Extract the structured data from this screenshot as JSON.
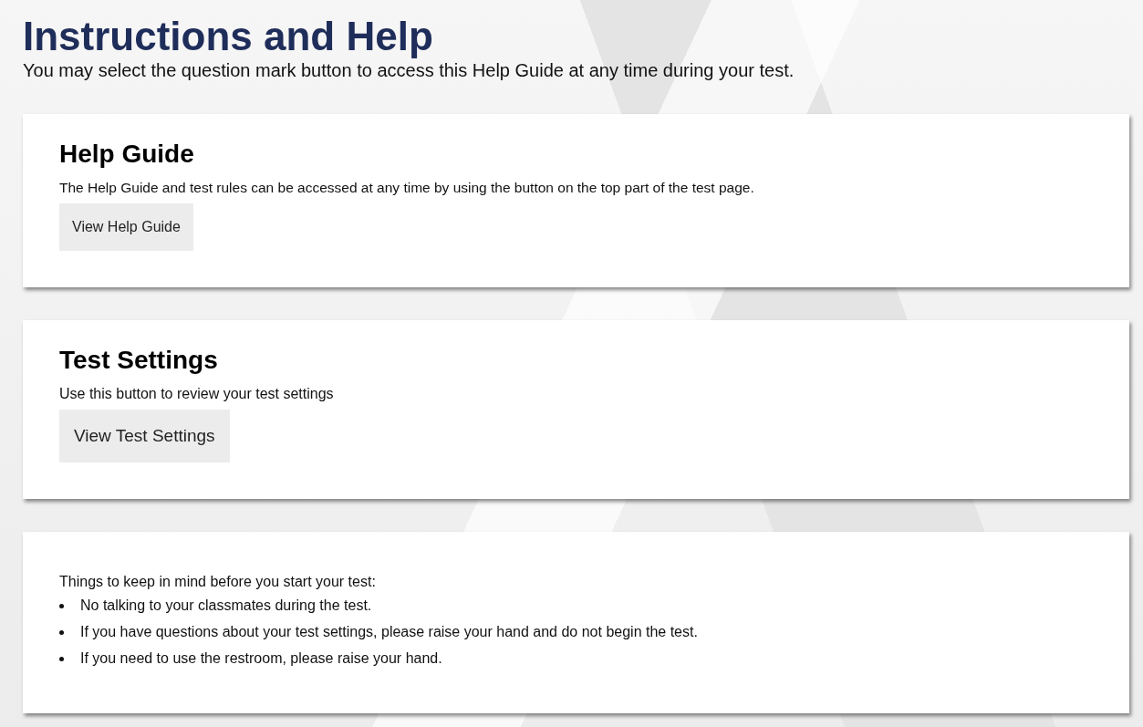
{
  "header": {
    "title": "Instructions and Help",
    "subtitle": "You may select the question mark button to access this Help Guide at any time during your test."
  },
  "cards": [
    {
      "kind": "section",
      "title": "Help Guide",
      "text": "The Help Guide and test rules can be accessed at any time by using the button on the top part of the test page.",
      "button": "View Help Guide"
    },
    {
      "kind": "section",
      "title": "Test Settings",
      "text": "Use this button to review your test settings",
      "button": "View Test Settings"
    },
    {
      "kind": "list",
      "text": "Things to keep in mind before you start your test:",
      "items": [
        "No talking to your classmates during the test.",
        "If you have questions about your test settings, please raise your hand and do not begin the test.",
        "If you need to use the restroom, please raise your hand."
      ]
    }
  ]
}
